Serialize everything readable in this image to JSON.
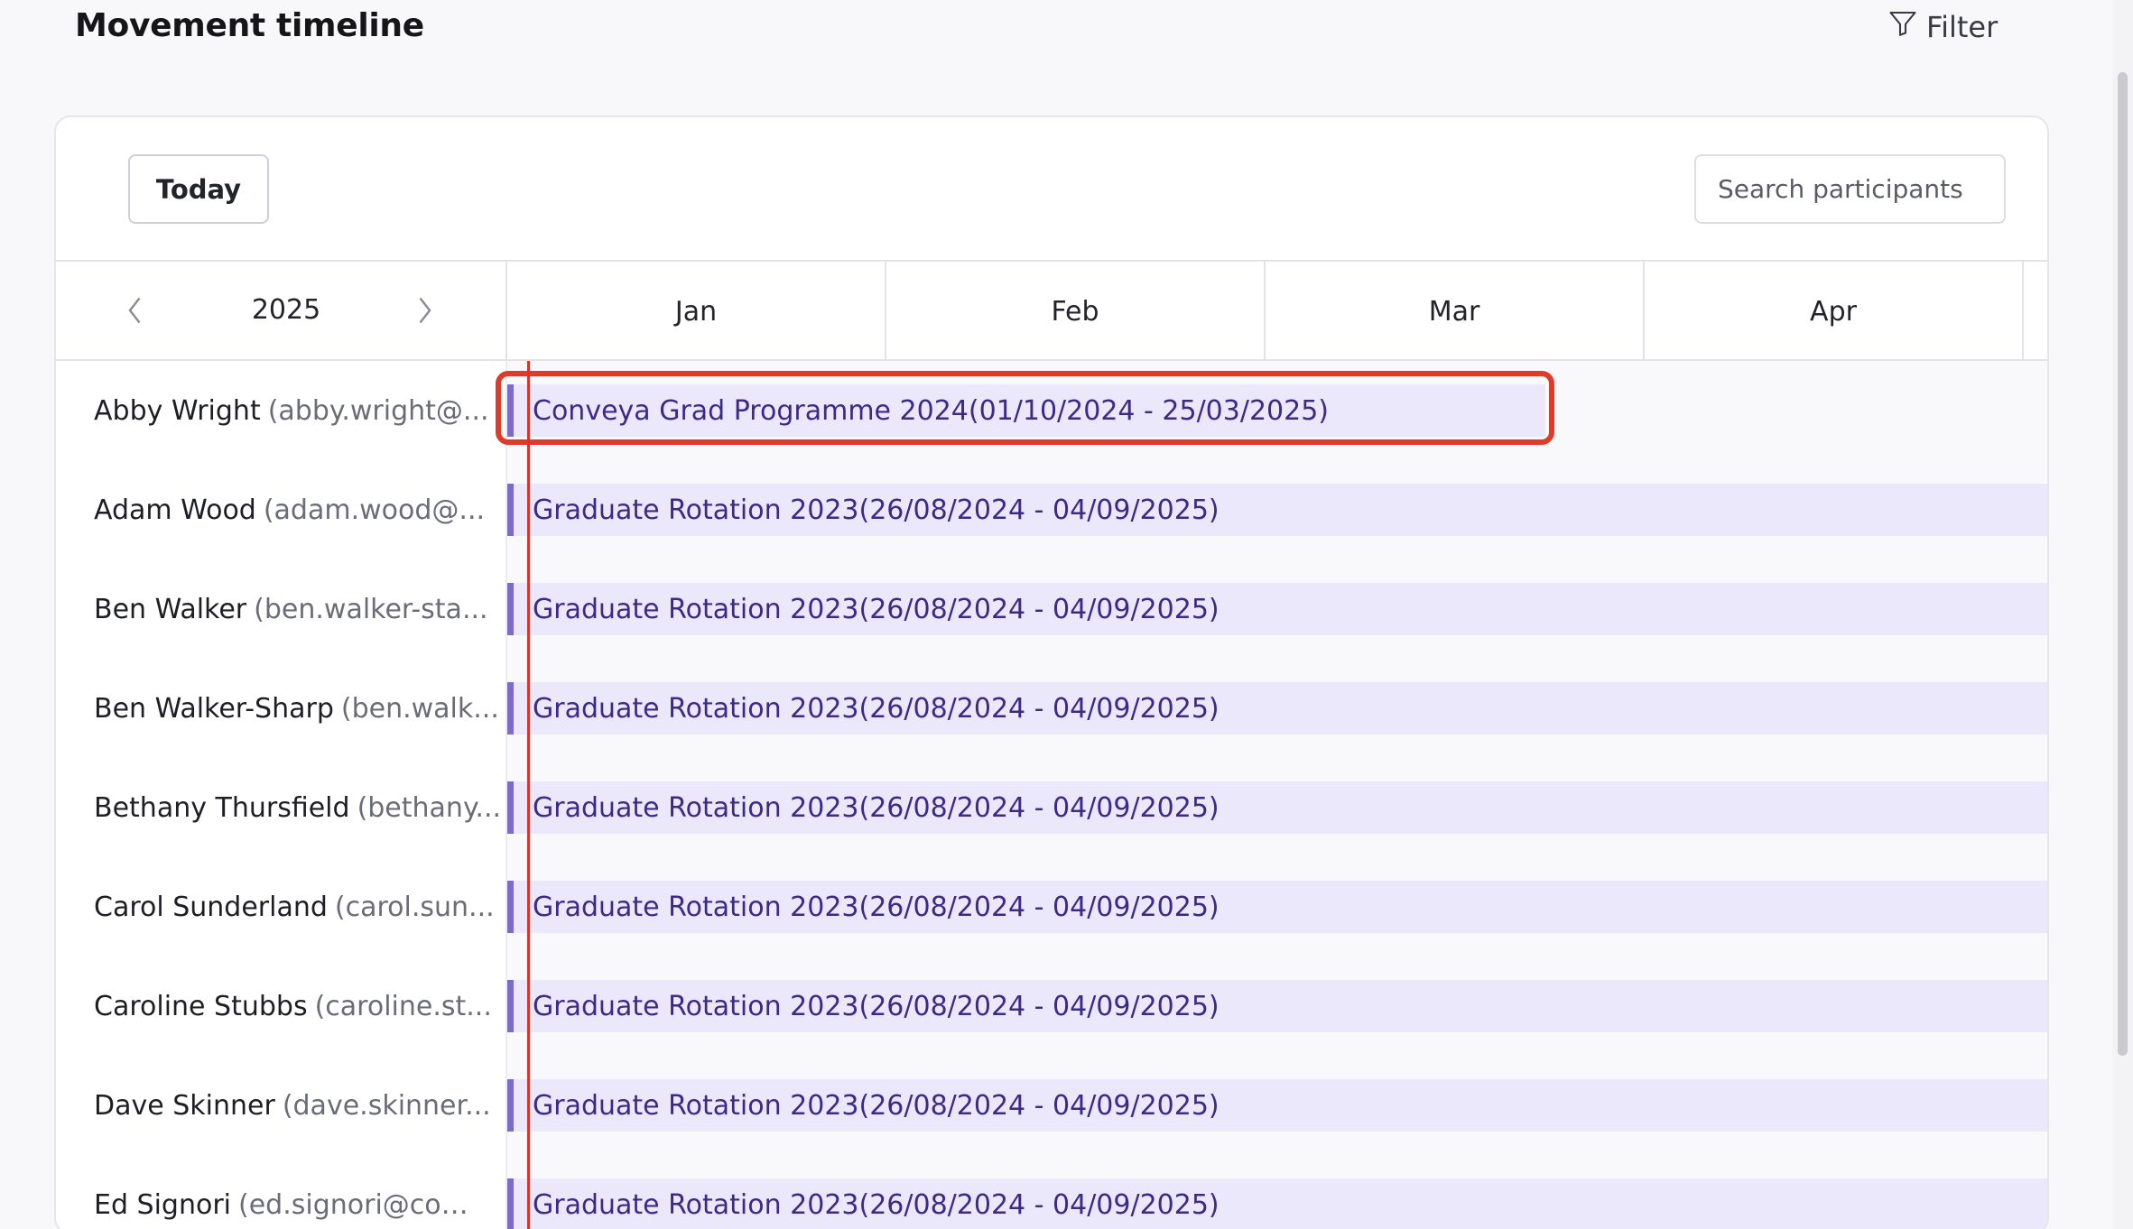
{
  "header": {
    "title": "Movement timeline",
    "filter_label": "Filter"
  },
  "toolbar": {
    "today_label": "Today",
    "search_placeholder": "Search participants"
  },
  "calendar": {
    "year": "2025",
    "months": [
      "Jan",
      "Feb",
      "Mar",
      "Apr"
    ]
  },
  "rows": [
    {
      "name": "Abby Wright",
      "email": "(abby.wright@...",
      "bar": "Conveya Grad Programme 2024(01/10/2024 - 25/03/2025)"
    },
    {
      "name": "Adam Wood",
      "email": "(adam.wood@...",
      "bar": "Graduate Rotation 2023(26/08/2024 - 04/09/2025)"
    },
    {
      "name": "Ben Walker",
      "email": "(ben.walker-sta...",
      "bar": "Graduate Rotation 2023(26/08/2024 - 04/09/2025)"
    },
    {
      "name": "Ben Walker-Sharp",
      "email": "(ben.walk...",
      "bar": "Graduate Rotation 2023(26/08/2024 - 04/09/2025)"
    },
    {
      "name": "Bethany Thursfield",
      "email": "(bethany...",
      "bar": "Graduate Rotation 2023(26/08/2024 - 04/09/2025)"
    },
    {
      "name": "Carol Sunderland",
      "email": "(carol.sun...",
      "bar": "Graduate Rotation 2023(26/08/2024 - 04/09/2025)"
    },
    {
      "name": "Caroline Stubbs",
      "email": "(caroline.st...",
      "bar": "Graduate Rotation 2023(26/08/2024 - 04/09/2025)"
    },
    {
      "name": "Dave Skinner",
      "email": "(dave.skinner...",
      "bar": "Graduate Rotation 2023(26/08/2024 - 04/09/2025)"
    },
    {
      "name": "Ed Signori",
      "email": "(ed.signori@conv...",
      "bar": "Graduate Rotation 2023(26/08/2024 - 04/09/2025)"
    }
  ],
  "colors": {
    "bar_bg": "#ebe8fb",
    "bar_accent": "#7d6ac9",
    "bar_text": "#3c2a86",
    "today_line": "#e0302a",
    "highlight": "#e03a2b"
  }
}
